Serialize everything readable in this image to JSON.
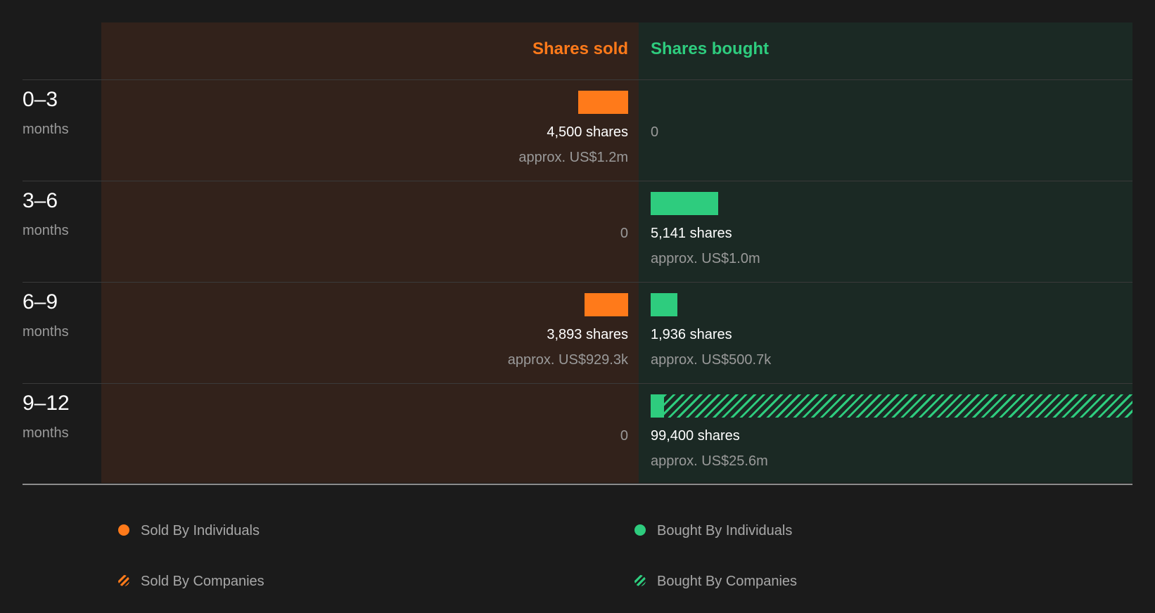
{
  "chart_data": {
    "type": "bar",
    "headers": {
      "sold": "Shares sold",
      "bought": "Shares bought"
    },
    "colors": {
      "sold": "#ff7a1a",
      "bought": "#2ecc7e",
      "sold_bg": "#32221b",
      "bought_bg": "#1b2924"
    },
    "unit_label": "months",
    "max_shares": 99400,
    "rows": [
      {
        "range": "0–3",
        "sold_shares": 4500,
        "sold_label": "4,500 shares",
        "sold_approx": "approx. US$1.2m",
        "bought_shares": 0,
        "bought_label": "0",
        "bought_approx": "",
        "bought_companies_shares": 0
      },
      {
        "range": "3–6",
        "sold_shares": 0,
        "sold_label": "0",
        "sold_approx": "",
        "bought_shares": 5141,
        "bought_label": "5,141 shares",
        "bought_approx": "approx. US$1.0m",
        "bought_companies_shares": 0
      },
      {
        "range": "6–9",
        "sold_shares": 3893,
        "sold_label": "3,893 shares",
        "sold_approx": "approx. US$929.3k",
        "bought_shares": 1936,
        "bought_label": "1,936 shares",
        "bought_approx": "approx. US$500.7k",
        "bought_companies_shares": 0
      },
      {
        "range": "9–12",
        "sold_shares": 0,
        "sold_label": "0",
        "sold_approx": "",
        "bought_shares": 3200,
        "bought_label": "99,400 shares",
        "bought_approx": "approx. US$25.6m",
        "bought_companies_shares": 96200
      }
    ],
    "legend": [
      {
        "label": "Sold By Individuals",
        "style": "solid",
        "color": "#ff7a1a"
      },
      {
        "label": "Bought By Individuals",
        "style": "solid",
        "color": "#2ecc7e"
      },
      {
        "label": "Sold By Companies",
        "style": "hatched",
        "color": "#ff7a1a"
      },
      {
        "label": "Bought By Companies",
        "style": "hatched",
        "color": "#2ecc7e"
      }
    ]
  }
}
